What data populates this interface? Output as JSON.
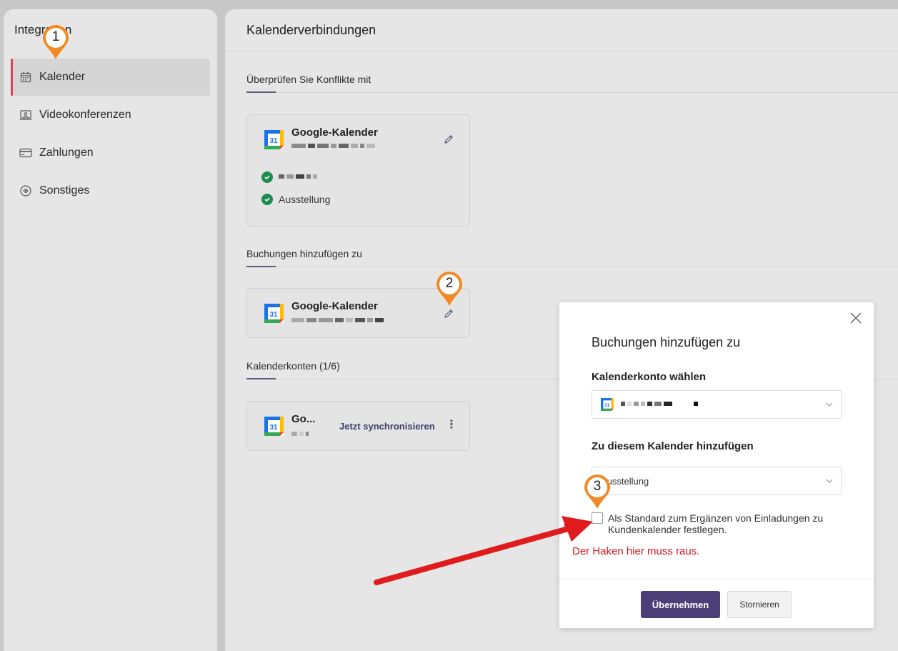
{
  "sidebar": {
    "title": "Integration",
    "items": [
      {
        "label": "Kalender",
        "icon": "calendar-icon",
        "active": true
      },
      {
        "label": "Videokonferenzen",
        "icon": "video-icon",
        "active": false
      },
      {
        "label": "Zahlungen",
        "icon": "credit-card-icon",
        "active": false
      },
      {
        "label": "Sonstiges",
        "icon": "other-icon",
        "active": false
      }
    ]
  },
  "main": {
    "title": "Kalenderverbindungen",
    "sections": {
      "conflicts": {
        "label": "Überprüfen Sie Konflikte mit",
        "card": {
          "title": "Google-Kalender",
          "calendars": [
            "Ausstellung"
          ]
        }
      },
      "add_bookings": {
        "label": "Buchungen hinzufügen zu",
        "card": {
          "title": "Google-Kalender"
        }
      },
      "accounts": {
        "label": "Kalenderkonten (1/6)",
        "card": {
          "title": "Go...",
          "sync_label": "Jetzt synchronisieren"
        }
      }
    }
  },
  "dialog": {
    "title": "Buchungen hinzufügen zu",
    "account_label": "Kalenderkonto wählen",
    "calendar_label": "Zu diesem Kalender hinzufügen",
    "calendar_value": "Ausstellung",
    "checkbox_label": "Als Standard zum Ergänzen von Einladungen zu Kundenkalender festlegen.",
    "checkbox_checked": false,
    "apply_label": "Übernehmen",
    "cancel_label": "Stornieren"
  },
  "annotations": {
    "markers": [
      "1",
      "2",
      "3"
    ],
    "note": "Der Haken hier muss raus.",
    "marker_color": "#f08a24",
    "arrow_color": "#e01b1b"
  },
  "colors": {
    "accent": "#4b3f77",
    "active_bar": "#d8435d",
    "check_green": "#1a8d4d"
  }
}
